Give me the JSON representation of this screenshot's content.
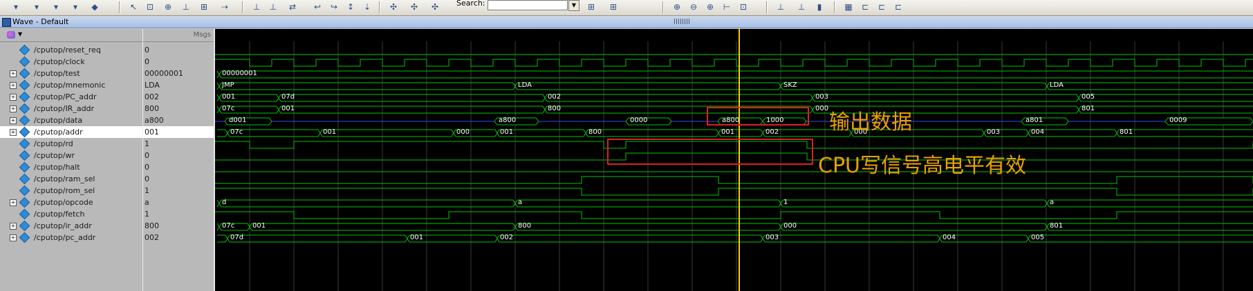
{
  "toolbar": {
    "search_label": "Search:",
    "search_value": "",
    "icons": [
      "add-wave-icon",
      "add-icon",
      "dataflow-icon",
      "save-icon",
      "run-icon",
      "select-icon",
      "zoom-region-icon",
      "insert-cursor-icon",
      "delete-cursor-icon",
      "mark-icon",
      "cursor-icon",
      "edge-icon",
      "prev-edge-icon",
      "next-edge-icon",
      "find-icon",
      "expand-icon",
      "collapse-icon",
      "search-forward-icon",
      "zoom-in-icon",
      "zoom-out-icon",
      "zoom-full-icon",
      "zoom-cursor-icon",
      "zoom-last-icon",
      "wave-style-icon",
      "list-icon",
      "dataflow-view-icon",
      "grid-icon",
      "fit-icon",
      "bracket-icon"
    ]
  },
  "window": {
    "title": "Wave - Default"
  },
  "panel": {
    "msgs_label": "Msgs"
  },
  "signals": [
    {
      "name": "/cputop/reset_req",
      "value": "0",
      "expandable": false
    },
    {
      "name": "/cputop/clock",
      "value": "0",
      "expandable": false
    },
    {
      "name": "/cputop/test",
      "value": "00000001",
      "expandable": true
    },
    {
      "name": "/cputop/mnemonic",
      "value": "LDA",
      "expandable": true
    },
    {
      "name": "/cputop/PC_addr",
      "value": "002",
      "expandable": true
    },
    {
      "name": "/cputop/IR_addr",
      "value": "800",
      "expandable": true
    },
    {
      "name": "/cputop/data",
      "value": "a800",
      "expandable": true
    },
    {
      "name": "/cputop/addr",
      "value": "001",
      "expandable": true,
      "selected": true
    },
    {
      "name": "/cputop/rd",
      "value": "1",
      "expandable": false
    },
    {
      "name": "/cputop/wr",
      "value": "0",
      "expandable": false
    },
    {
      "name": "/cputop/halt",
      "value": "0",
      "expandable": false
    },
    {
      "name": "/cputop/ram_sel",
      "value": "0",
      "expandable": false
    },
    {
      "name": "/cputop/rom_sel",
      "value": "1",
      "expandable": false
    },
    {
      "name": "/cputop/opcode",
      "value": "a",
      "expandable": true
    },
    {
      "name": "/cputop/fetch",
      "value": "1",
      "expandable": false
    },
    {
      "name": "/cputop/ir_addr",
      "value": "800",
      "expandable": true
    },
    {
      "name": "/cputop/pc_addr",
      "value": "002",
      "expandable": true
    }
  ],
  "bus_labels": {
    "test": [
      {
        "t": 6,
        "text": "00000001"
      }
    ],
    "mnemonic": [
      {
        "t": 6,
        "text": "JMP"
      },
      {
        "t": 434,
        "text": "LDA"
      },
      {
        "t": 818,
        "text": "SKZ"
      },
      {
        "t": 1203,
        "text": "LDA"
      }
    ],
    "pc_addr_u": [
      {
        "t": 6,
        "text": "001"
      },
      {
        "t": 92,
        "text": "07d"
      },
      {
        "t": 477,
        "text": "002"
      },
      {
        "t": 864,
        "text": "003"
      },
      {
        "t": 1249,
        "text": "005"
      }
    ],
    "ir_addr_u": [
      {
        "t": 6,
        "text": "07c"
      },
      {
        "t": 92,
        "text": "001"
      },
      {
        "t": 477,
        "text": "800"
      },
      {
        "t": 864,
        "text": "000"
      },
      {
        "t": 1249,
        "text": "801"
      }
    ],
    "data": [
      {
        "t": 18,
        "text": "d001"
      },
      {
        "t": 408,
        "text": "a800"
      },
      {
        "t": 598,
        "text": "0000"
      },
      {
        "t": 731,
        "text": "a800"
      },
      {
        "t": 795,
        "text": "1000"
      },
      {
        "t": 1170,
        "text": "a801"
      },
      {
        "t": 1378,
        "text": "0009"
      }
    ],
    "addr": [
      {
        "t": 18,
        "text": "07c"
      },
      {
        "t": 152,
        "text": "001"
      },
      {
        "t": 345,
        "text": "000"
      },
      {
        "t": 408,
        "text": "001"
      },
      {
        "t": 536,
        "text": "800"
      },
      {
        "t": 728,
        "text": "001"
      },
      {
        "t": 792,
        "text": "002"
      },
      {
        "t": 920,
        "text": "000"
      },
      {
        "t": 1112,
        "text": "003"
      },
      {
        "t": 1176,
        "text": "004"
      },
      {
        "t": 1304,
        "text": "801"
      }
    ],
    "opcode": [
      {
        "t": 6,
        "text": "d"
      },
      {
        "t": 434,
        "text": "a"
      },
      {
        "t": 818,
        "text": "1"
      },
      {
        "t": 1203,
        "text": "a"
      }
    ],
    "ir_addr": [
      {
        "t": 6,
        "text": "07c"
      },
      {
        "t": 50,
        "text": "001"
      },
      {
        "t": 434,
        "text": "800"
      },
      {
        "t": 818,
        "text": "000"
      },
      {
        "t": 1203,
        "text": "801"
      }
    ],
    "pc_addr": [
      {
        "t": 18,
        "text": "07d"
      },
      {
        "t": 278,
        "text": "001"
      },
      {
        "t": 408,
        "text": "002"
      },
      {
        "t": 792,
        "text": "003"
      },
      {
        "t": 1048,
        "text": "004"
      },
      {
        "t": 1176,
        "text": "005"
      }
    ]
  },
  "annotations": {
    "output_data": "输出数据",
    "cpu_write": "CPU写信号高电平有效"
  },
  "colors": {
    "wave": "#00c800",
    "data_line": "#4040ff",
    "cursor": "#f0d000",
    "annotation_box": "#e02020",
    "annotation_text": "#e8a000",
    "grid": "#2a2a2a"
  }
}
